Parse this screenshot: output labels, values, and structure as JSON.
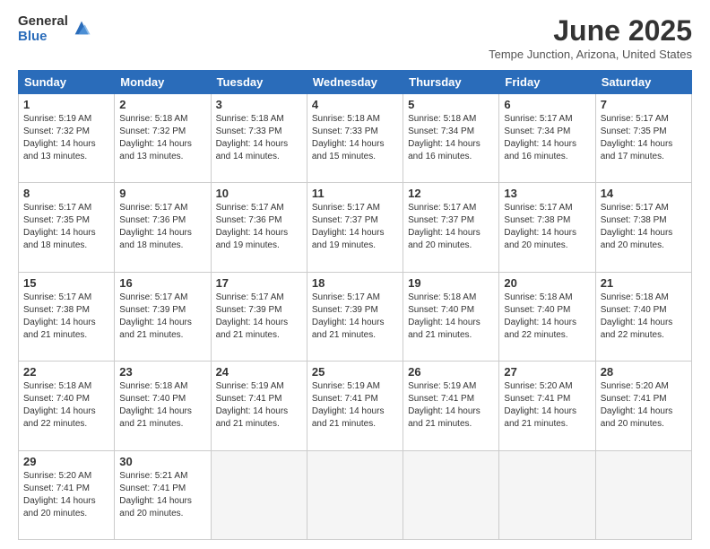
{
  "header": {
    "logo_general": "General",
    "logo_blue": "Blue",
    "title": "June 2025",
    "location": "Tempe Junction, Arizona, United States"
  },
  "weekdays": [
    "Sunday",
    "Monday",
    "Tuesday",
    "Wednesday",
    "Thursday",
    "Friday",
    "Saturday"
  ],
  "weeks": [
    [
      {
        "day": "1",
        "lines": [
          "Sunrise: 5:19 AM",
          "Sunset: 7:32 PM",
          "Daylight: 14 hours",
          "and 13 minutes."
        ]
      },
      {
        "day": "2",
        "lines": [
          "Sunrise: 5:18 AM",
          "Sunset: 7:32 PM",
          "Daylight: 14 hours",
          "and 13 minutes."
        ]
      },
      {
        "day": "3",
        "lines": [
          "Sunrise: 5:18 AM",
          "Sunset: 7:33 PM",
          "Daylight: 14 hours",
          "and 14 minutes."
        ]
      },
      {
        "day": "4",
        "lines": [
          "Sunrise: 5:18 AM",
          "Sunset: 7:33 PM",
          "Daylight: 14 hours",
          "and 15 minutes."
        ]
      },
      {
        "day": "5",
        "lines": [
          "Sunrise: 5:18 AM",
          "Sunset: 7:34 PM",
          "Daylight: 14 hours",
          "and 16 minutes."
        ]
      },
      {
        "day": "6",
        "lines": [
          "Sunrise: 5:17 AM",
          "Sunset: 7:34 PM",
          "Daylight: 14 hours",
          "and 16 minutes."
        ]
      },
      {
        "day": "7",
        "lines": [
          "Sunrise: 5:17 AM",
          "Sunset: 7:35 PM",
          "Daylight: 14 hours",
          "and 17 minutes."
        ]
      }
    ],
    [
      {
        "day": "8",
        "lines": [
          "Sunrise: 5:17 AM",
          "Sunset: 7:35 PM",
          "Daylight: 14 hours",
          "and 18 minutes."
        ]
      },
      {
        "day": "9",
        "lines": [
          "Sunrise: 5:17 AM",
          "Sunset: 7:36 PM",
          "Daylight: 14 hours",
          "and 18 minutes."
        ]
      },
      {
        "day": "10",
        "lines": [
          "Sunrise: 5:17 AM",
          "Sunset: 7:36 PM",
          "Daylight: 14 hours",
          "and 19 minutes."
        ]
      },
      {
        "day": "11",
        "lines": [
          "Sunrise: 5:17 AM",
          "Sunset: 7:37 PM",
          "Daylight: 14 hours",
          "and 19 minutes."
        ]
      },
      {
        "day": "12",
        "lines": [
          "Sunrise: 5:17 AM",
          "Sunset: 7:37 PM",
          "Daylight: 14 hours",
          "and 20 minutes."
        ]
      },
      {
        "day": "13",
        "lines": [
          "Sunrise: 5:17 AM",
          "Sunset: 7:38 PM",
          "Daylight: 14 hours",
          "and 20 minutes."
        ]
      },
      {
        "day": "14",
        "lines": [
          "Sunrise: 5:17 AM",
          "Sunset: 7:38 PM",
          "Daylight: 14 hours",
          "and 20 minutes."
        ]
      }
    ],
    [
      {
        "day": "15",
        "lines": [
          "Sunrise: 5:17 AM",
          "Sunset: 7:38 PM",
          "Daylight: 14 hours",
          "and 21 minutes."
        ]
      },
      {
        "day": "16",
        "lines": [
          "Sunrise: 5:17 AM",
          "Sunset: 7:39 PM",
          "Daylight: 14 hours",
          "and 21 minutes."
        ]
      },
      {
        "day": "17",
        "lines": [
          "Sunrise: 5:17 AM",
          "Sunset: 7:39 PM",
          "Daylight: 14 hours",
          "and 21 minutes."
        ]
      },
      {
        "day": "18",
        "lines": [
          "Sunrise: 5:17 AM",
          "Sunset: 7:39 PM",
          "Daylight: 14 hours",
          "and 21 minutes."
        ]
      },
      {
        "day": "19",
        "lines": [
          "Sunrise: 5:18 AM",
          "Sunset: 7:40 PM",
          "Daylight: 14 hours",
          "and 21 minutes."
        ]
      },
      {
        "day": "20",
        "lines": [
          "Sunrise: 5:18 AM",
          "Sunset: 7:40 PM",
          "Daylight: 14 hours",
          "and 22 minutes."
        ]
      },
      {
        "day": "21",
        "lines": [
          "Sunrise: 5:18 AM",
          "Sunset: 7:40 PM",
          "Daylight: 14 hours",
          "and 22 minutes."
        ]
      }
    ],
    [
      {
        "day": "22",
        "lines": [
          "Sunrise: 5:18 AM",
          "Sunset: 7:40 PM",
          "Daylight: 14 hours",
          "and 22 minutes."
        ]
      },
      {
        "day": "23",
        "lines": [
          "Sunrise: 5:18 AM",
          "Sunset: 7:40 PM",
          "Daylight: 14 hours",
          "and 21 minutes."
        ]
      },
      {
        "day": "24",
        "lines": [
          "Sunrise: 5:19 AM",
          "Sunset: 7:41 PM",
          "Daylight: 14 hours",
          "and 21 minutes."
        ]
      },
      {
        "day": "25",
        "lines": [
          "Sunrise: 5:19 AM",
          "Sunset: 7:41 PM",
          "Daylight: 14 hours",
          "and 21 minutes."
        ]
      },
      {
        "day": "26",
        "lines": [
          "Sunrise: 5:19 AM",
          "Sunset: 7:41 PM",
          "Daylight: 14 hours",
          "and 21 minutes."
        ]
      },
      {
        "day": "27",
        "lines": [
          "Sunrise: 5:20 AM",
          "Sunset: 7:41 PM",
          "Daylight: 14 hours",
          "and 21 minutes."
        ]
      },
      {
        "day": "28",
        "lines": [
          "Sunrise: 5:20 AM",
          "Sunset: 7:41 PM",
          "Daylight: 14 hours",
          "and 20 minutes."
        ]
      }
    ],
    [
      {
        "day": "29",
        "lines": [
          "Sunrise: 5:20 AM",
          "Sunset: 7:41 PM",
          "Daylight: 14 hours",
          "and 20 minutes."
        ]
      },
      {
        "day": "30",
        "lines": [
          "Sunrise: 5:21 AM",
          "Sunset: 7:41 PM",
          "Daylight: 14 hours",
          "and 20 minutes."
        ]
      },
      {
        "day": "",
        "lines": []
      },
      {
        "day": "",
        "lines": []
      },
      {
        "day": "",
        "lines": []
      },
      {
        "day": "",
        "lines": []
      },
      {
        "day": "",
        "lines": []
      }
    ]
  ]
}
